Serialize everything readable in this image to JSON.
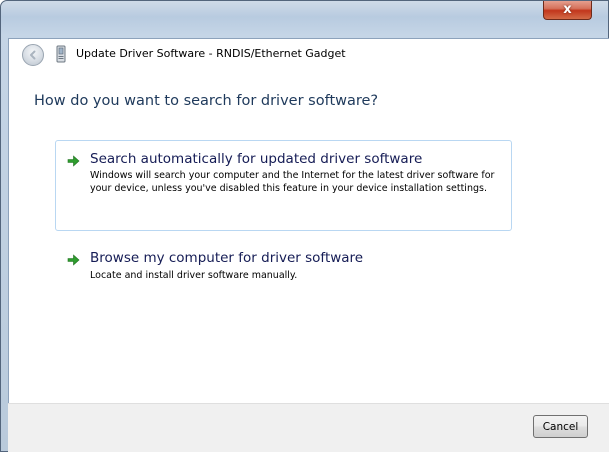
{
  "window": {
    "close_glyph": "x",
    "title": "Update Driver Software - RNDIS/Ethernet Gadget",
    "title_icon": "driver-device-icon",
    "back_icon": "back-arrow-icon"
  },
  "main": {
    "heading": "How do you want to search for driver software?",
    "options": [
      {
        "title": "Search automatically for updated driver software",
        "description": "Windows will search your computer and the Internet for the latest driver software for your device, unless you've disabled this feature in your device installation settings.",
        "icon": "green-arrow-icon",
        "selected": true
      },
      {
        "title": "Browse my computer for driver software",
        "description": "Locate and install driver software manually.",
        "icon": "green-arrow-icon",
        "selected": false
      }
    ]
  },
  "footer": {
    "cancel_label": "Cancel"
  },
  "colors": {
    "heading": "#1e395b",
    "option_title": "#151c55",
    "selection_border": "#b9d7f2",
    "arrow_green": "#2e9d2e",
    "close_red": "#c2361c",
    "footer_bg": "#f0f0f0"
  }
}
